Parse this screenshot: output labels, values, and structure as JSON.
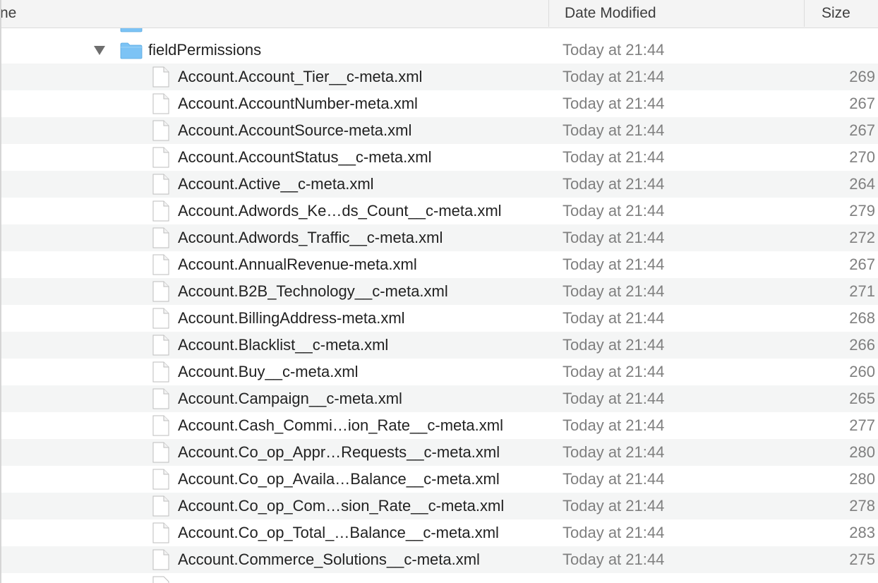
{
  "header": {
    "name_label": "ne",
    "date_label": "Date Modified",
    "size_label": "Size"
  },
  "colors": {
    "folder": "#7cc3f5",
    "stripe": "#f4f5f5",
    "secondary_text": "#7f7f7f"
  },
  "folder": {
    "name": "fieldPermissions",
    "date": "Today at 21:44",
    "expanded": true,
    "icon": "folder-icon"
  },
  "files": [
    {
      "name": "Account.Account_Tier__c-meta.xml",
      "date": "Today at 21:44",
      "size": "269"
    },
    {
      "name": "Account.AccountNumber-meta.xml",
      "date": "Today at 21:44",
      "size": "267"
    },
    {
      "name": "Account.AccountSource-meta.xml",
      "date": "Today at 21:44",
      "size": "267"
    },
    {
      "name": "Account.AccountStatus__c-meta.xml",
      "date": "Today at 21:44",
      "size": "270"
    },
    {
      "name": "Account.Active__c-meta.xml",
      "date": "Today at 21:44",
      "size": "264"
    },
    {
      "name": "Account.Adwords_Ke…ds_Count__c-meta.xml",
      "date": "Today at 21:44",
      "size": "279"
    },
    {
      "name": "Account.Adwords_Traffic__c-meta.xml",
      "date": "Today at 21:44",
      "size": "272"
    },
    {
      "name": "Account.AnnualRevenue-meta.xml",
      "date": "Today at 21:44",
      "size": "267"
    },
    {
      "name": "Account.B2B_Technology__c-meta.xml",
      "date": "Today at 21:44",
      "size": "271"
    },
    {
      "name": "Account.BillingAddress-meta.xml",
      "date": "Today at 21:44",
      "size": "268"
    },
    {
      "name": "Account.Blacklist__c-meta.xml",
      "date": "Today at 21:44",
      "size": "266"
    },
    {
      "name": "Account.Buy__c-meta.xml",
      "date": "Today at 21:44",
      "size": "260"
    },
    {
      "name": "Account.Campaign__c-meta.xml",
      "date": "Today at 21:44",
      "size": "265"
    },
    {
      "name": "Account.Cash_Commi…ion_Rate__c-meta.xml",
      "date": "Today at 21:44",
      "size": "277"
    },
    {
      "name": "Account.Co_op_Appr…Requests__c-meta.xml",
      "date": "Today at 21:44",
      "size": "280"
    },
    {
      "name": "Account.Co_op_Availa…Balance__c-meta.xml",
      "date": "Today at 21:44",
      "size": "280"
    },
    {
      "name": "Account.Co_op_Com…sion_Rate__c-meta.xml",
      "date": "Today at 21:44",
      "size": "278"
    },
    {
      "name": "Account.Co_op_Total_…Balance__c-meta.xml",
      "date": "Today at 21:44",
      "size": "283"
    },
    {
      "name": "Account.Commerce_Solutions__c-meta.xml",
      "date": "Today at 21:44",
      "size": "275"
    }
  ]
}
